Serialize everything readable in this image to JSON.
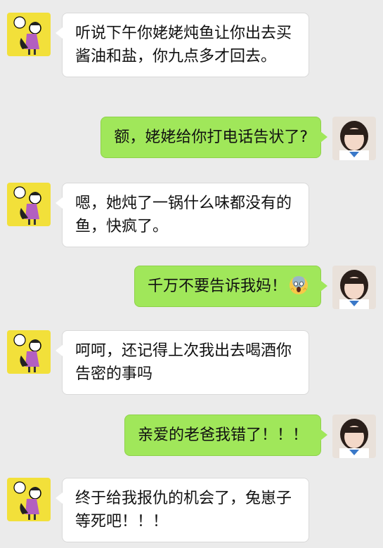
{
  "messages": [
    {
      "side": "left",
      "text": "听说下午你姥姥炖鱼让你出去买酱油和盐，你九点多才回去。"
    },
    {
      "side": "right",
      "text": "额，姥姥给你打电话告状了?"
    },
    {
      "side": "left",
      "text": "嗯，她炖了一锅什么味都没有的鱼，快疯了。"
    },
    {
      "side": "right",
      "text": "千万不要告诉我妈！",
      "emoji": "scream-emoji"
    },
    {
      "side": "left",
      "text": "呵呵，还记得上次我出去喝酒你告密的事吗"
    },
    {
      "side": "right",
      "text": "亲爱的老爸我错了！！！"
    },
    {
      "side": "left",
      "text": "终于给我报仇的机会了，兔崽子等死吧！！！"
    }
  ],
  "colors": {
    "background": "#ebebeb",
    "sent_bubble": "#a0e75a",
    "received_bubble": "#ffffff",
    "avatar_left_bg": "#f2e03a"
  }
}
